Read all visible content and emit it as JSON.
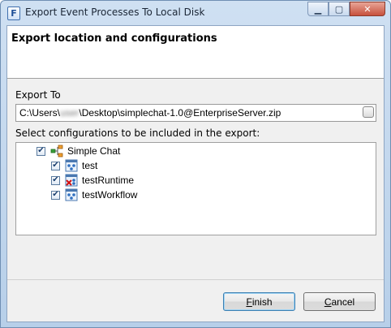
{
  "window": {
    "title": "Export Event Processes To Local Disk",
    "app_icon_glyph": "F",
    "controls": {
      "minimize": "▁",
      "maximize": "▢",
      "close": "✕"
    }
  },
  "header": {
    "title": "Export location and configurations"
  },
  "export_to": {
    "label": "Export To",
    "path_prefix": "C:\\Users\\",
    "path_user": "user",
    "path_suffix": "\\Desktop\\simplechat-1.0@EnterpriseServer.zip"
  },
  "configurations": {
    "label": "Select configurations to be included in the export:",
    "root": {
      "label": "Simple Chat",
      "checked": true,
      "icon": "project-tree-icon"
    },
    "items": [
      {
        "label": "test",
        "checked": true,
        "icon": "configuration-icon"
      },
      {
        "label": "testRuntime",
        "checked": true,
        "icon": "configuration-error-icon"
      },
      {
        "label": "testWorkflow",
        "checked": true,
        "icon": "configuration-icon"
      }
    ]
  },
  "buttons": {
    "finish": "Finish",
    "cancel": "Cancel"
  },
  "colors": {
    "accent": "#3c7fb1",
    "title_bar": "#b7cfe9",
    "dialog_bg": "#f0f0f0"
  }
}
